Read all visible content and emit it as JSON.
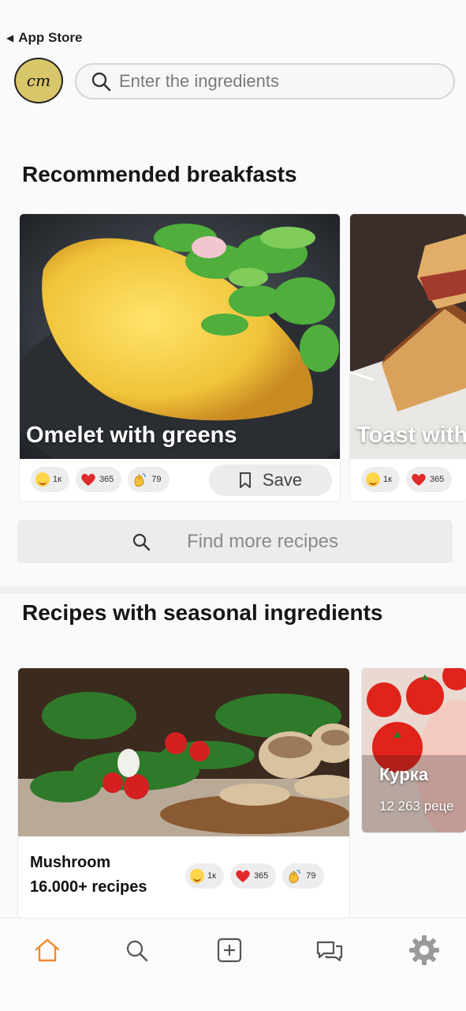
{
  "status_bar": {
    "back_label": "App Store"
  },
  "header": {
    "logo_text": "cm",
    "search_placeholder": "Enter the ingredients"
  },
  "section_breakfasts": {
    "title": "Recommended breakfasts",
    "cards": [
      {
        "title": "Omelet with greens",
        "reactions": {
          "smile": "1к",
          "heart": "365",
          "clap": "79"
        },
        "save_label": "Save"
      },
      {
        "title": "Toast with",
        "reactions": {
          "smile": "1к",
          "heart": "365"
        }
      }
    ]
  },
  "find_more": {
    "label": "Find more recipes"
  },
  "section_seasonal": {
    "title": "Recipes with seasonal ingredients",
    "cards": [
      {
        "title": "Mushroom",
        "subtitle": "16.000+ recipes",
        "reactions": {
          "smile": "1к",
          "heart": "365",
          "clap": "79"
        }
      },
      {
        "title": "Курка",
        "subtitle": "12 263 реце"
      }
    ]
  },
  "tabbar": {
    "items": [
      {
        "icon": "home-icon",
        "active": true
      },
      {
        "icon": "search-icon",
        "active": false
      },
      {
        "icon": "add-icon",
        "active": false
      },
      {
        "icon": "chat-icon",
        "active": false
      },
      {
        "icon": "gear-icon",
        "active": false
      }
    ]
  },
  "colors": {
    "accent": "#f08a2a",
    "logo_bg": "#d8c66a",
    "pill_bg": "#ededed"
  }
}
